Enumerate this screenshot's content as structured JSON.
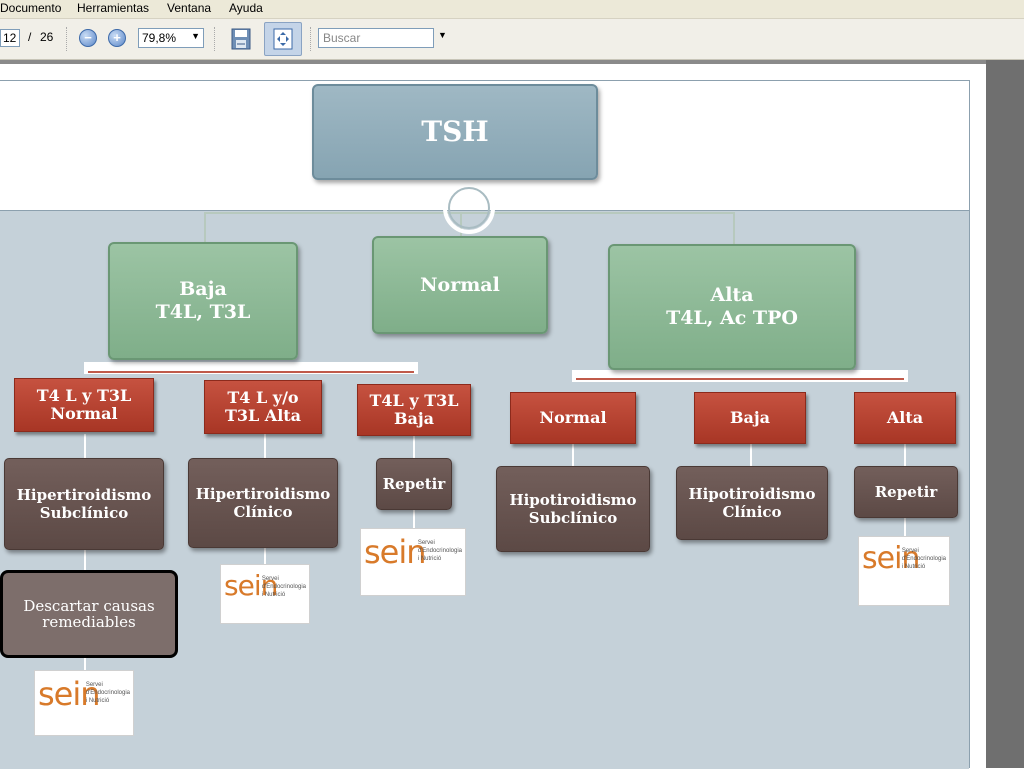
{
  "menu": {
    "documento": "Documento",
    "herramientas": "Herramientas",
    "ventana": "Ventana",
    "ayuda": "Ayuda"
  },
  "toolbar": {
    "page_current": "12",
    "page_separator": "/",
    "page_total": "26",
    "zoom_value": "79,8%",
    "search_placeholder": "Buscar"
  },
  "chart": {
    "root": "TSH",
    "level1": {
      "baja": "Baja\nT4L, T3L",
      "normal": "Normal",
      "alta": "Alta\nT4L, Ac TPO"
    },
    "baja_children": {
      "normal": "T4 L y T3L\nNormal",
      "alta": "T4 L y/o\nT3L  Alta",
      "baja": "T4L y T3L\nBaja"
    },
    "alta_children": {
      "normal": "Normal",
      "baja": "Baja",
      "alta": "Alta"
    },
    "results": {
      "hiper_subclinico": "Hipertiroidismo\nSubclínico",
      "hiper_clinico": "Hipertiroidismo\nClínico",
      "repetir_1": "Repetir",
      "hipo_subclinico": "Hipotiroidismo\nSubclínico",
      "hipo_clinico": "Hipotiroidismo\nClínico",
      "repetir_2": "Repetir"
    },
    "descartar": "Descartar causas\nremediables"
  },
  "logo": {
    "word": "sein",
    "subtitle": "Servei\nd'Endocrinologia\ni Nutrició"
  },
  "colors": {
    "tsh": "#8eadbb",
    "green": "#8cb896",
    "red": "#b8402e",
    "brown": "#675350",
    "panel": "#c5d1d9",
    "logo_orange": "#d87a2a"
  }
}
